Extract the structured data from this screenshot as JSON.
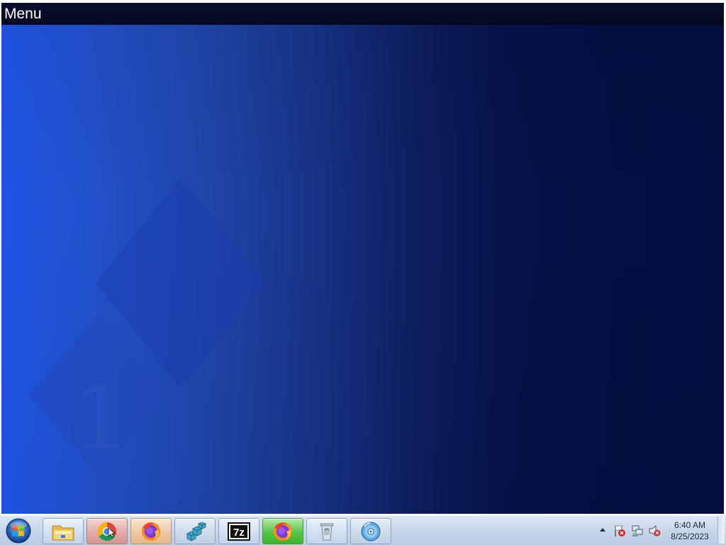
{
  "app": {
    "menu_label": "Menu",
    "background_gradient": [
      "#1e55e6",
      "#163285",
      "#040e40"
    ],
    "watermark_glyph": "1"
  },
  "taskbar": {
    "start_icon": "windows-start-orb-icon",
    "pinned": [
      {
        "name": "file-explorer",
        "icon": "folder-icon"
      },
      {
        "name": "google-chrome",
        "icon": "chrome-icon"
      },
      {
        "name": "firefox",
        "icon": "firefox-icon"
      },
      {
        "name": "registry-editor",
        "icon": "registry-cubes-icon"
      },
      {
        "name": "7-zip",
        "icon": "7zip-icon",
        "text": "7z"
      },
      {
        "name": "firefox-active",
        "icon": "firefox-icon"
      },
      {
        "name": "recycle-bin",
        "icon": "recycle-bin-icon"
      },
      {
        "name": "media-player",
        "icon": "cd-disc-icon"
      }
    ],
    "tray": {
      "show_hidden_icon": "chevron-up-icon",
      "action_center_icon": "flag-warning-icon",
      "network_icon": "network-disconnected-icon",
      "volume_icon": "speaker-muted-icon",
      "time": "6:40 AM",
      "date": "8/25/2023"
    }
  },
  "colors": {
    "taskbar_top": "#dbe6f3",
    "taskbar_bottom": "#b9cbe3",
    "menu_bar": "#04081e",
    "active_task_green": "#3ab42c"
  }
}
